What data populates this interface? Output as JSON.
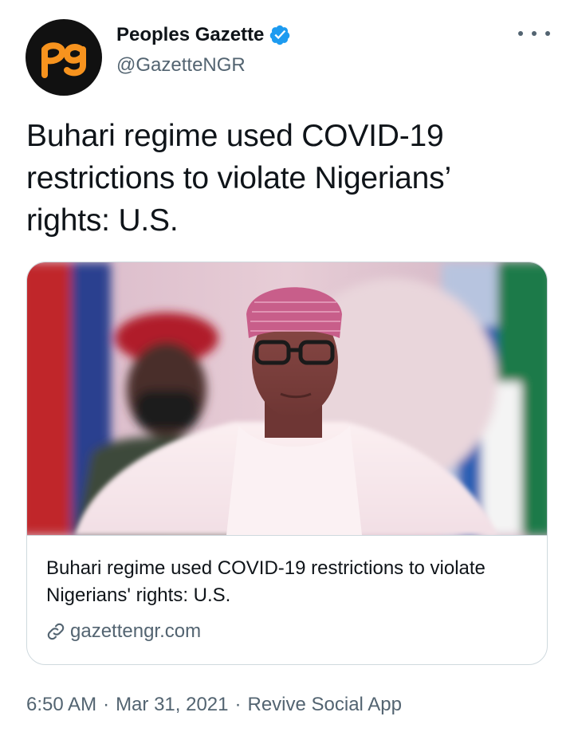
{
  "author": {
    "display_name": "Peoples Gazette",
    "handle": "@GazetteNGR",
    "verified": true,
    "avatar_logo_text": "pg",
    "avatar_bg_color": "#111111",
    "avatar_logo_color": "#f7931e",
    "verified_badge_color": "#1d9bf0"
  },
  "menu": {
    "icon": "more-horizontal-icon"
  },
  "tweet": {
    "text": "Buhari regime used COVID-19\nrestrictions to violate Nigerians’\nrights: U.S."
  },
  "link_card": {
    "image_description_icon": "news-photo",
    "title": "Buhari regime used COVID-19 restrictions to violate Nigerians' rights: U.S.",
    "domain": "gazettengr.com",
    "link_icon": "link-icon"
  },
  "meta": {
    "time": "6:50 AM",
    "separator": "·",
    "date": "Mar 31, 2021",
    "source": "Revive Social App"
  },
  "colors": {
    "text_primary": "#0f1419",
    "text_secondary": "#536471",
    "border": "#cfd9de"
  }
}
